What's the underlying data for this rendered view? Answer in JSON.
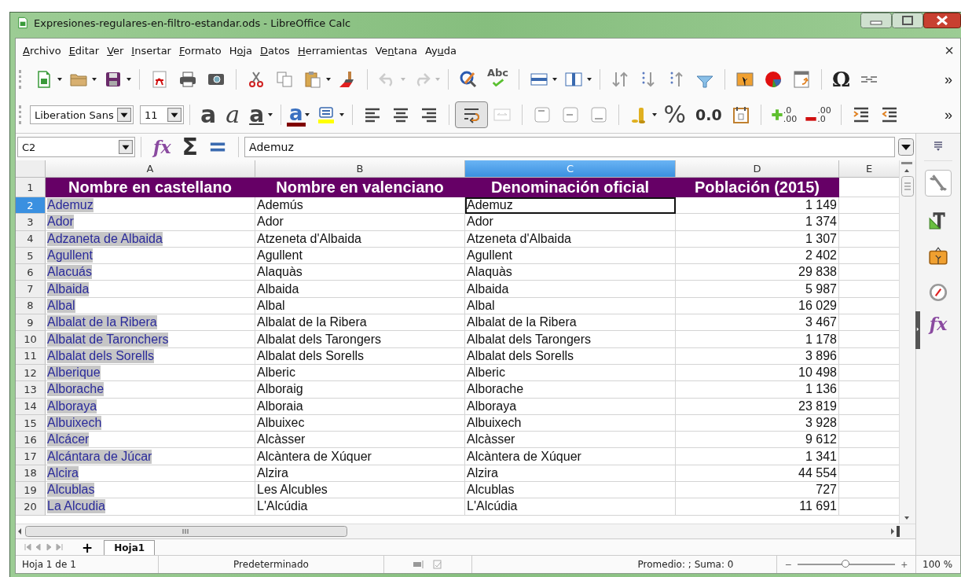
{
  "window": {
    "title": "Expresiones-regulares-en-filtro-estandar.ods - LibreOffice Calc"
  },
  "menu": [
    {
      "key": "A",
      "after": "rchivo"
    },
    {
      "key": "E",
      "after": "ditar"
    },
    {
      "key": "V",
      "after": "er"
    },
    {
      "key": "I",
      "after": "nsertar"
    },
    {
      "key": "F",
      "after": "ormato"
    },
    {
      "before": "H",
      "key": "o",
      "after": "ja"
    },
    {
      "key": "D",
      "after": "atos"
    },
    {
      "key": "H",
      "after": "erramientas"
    },
    {
      "before": "Ve",
      "key": "n",
      "after": "tana"
    },
    {
      "before": "Ay",
      "key": "u",
      "after": "da"
    }
  ],
  "close_document": "×",
  "toolbar_standard": {
    "spelling_label": "Abc",
    "special_character": "Ω",
    "more": "»"
  },
  "toolbar_formatting": {
    "font_name": "Liberation Sans",
    "font_size": "11",
    "bold": "a",
    "italic": "a",
    "underline": "a",
    "font_color": "a",
    "wrap_text_on": true,
    "percent": "%",
    "number_format": "0.0",
    "add_decimal": [
      ".0",
      ".00"
    ],
    "delete_decimal": [
      ".00",
      ".0"
    ],
    "more": "»"
  },
  "formula_bar": {
    "name_box": "C2",
    "wizard": "fx",
    "sum": "Σ",
    "content": "Ademuz"
  },
  "sheet": {
    "columns": [
      {
        "label": "A",
        "selected": false,
        "highlight": true
      },
      {
        "label": "B",
        "selected": false
      },
      {
        "label": "C",
        "selected": true
      },
      {
        "label": "D",
        "selected": false
      },
      {
        "label": "E",
        "selected": false
      }
    ],
    "rows": [
      {
        "number": "1",
        "selected": false,
        "kind": "header",
        "cells": [
          "Nombre en castellano",
          "Nombre en valenciano",
          "Denominación oficial",
          "Población (2015)"
        ]
      },
      {
        "number": "2",
        "selected": true,
        "kind": "data",
        "cells": [
          "Ademuz",
          "Ademús",
          "Ademuz",
          "1 149"
        ]
      },
      {
        "number": "3",
        "selected": false,
        "kind": "data",
        "cells": [
          "Ador",
          "Ador",
          "Ador",
          "1 374"
        ]
      },
      {
        "number": "4",
        "selected": false,
        "kind": "data",
        "cells": [
          "Adzaneta de Albaida",
          "Atzeneta d'Albaida",
          "Atzeneta d'Albaida",
          "1 307"
        ]
      },
      {
        "number": "5",
        "selected": false,
        "kind": "data",
        "cells": [
          "Agullent",
          "Agullent",
          "Agullent",
          "2 402"
        ]
      },
      {
        "number": "6",
        "selected": false,
        "kind": "data",
        "cells": [
          "Alacuás",
          "Alaquàs",
          "Alaquàs",
          "29 838"
        ]
      },
      {
        "number": "7",
        "selected": false,
        "kind": "data",
        "cells": [
          "Albaida",
          "Albaida",
          "Albaida",
          "5 987"
        ]
      },
      {
        "number": "8",
        "selected": false,
        "kind": "data",
        "cells": [
          "Albal",
          "Albal",
          "Albal",
          "16 029"
        ]
      },
      {
        "number": "9",
        "selected": false,
        "kind": "data",
        "cells": [
          "Albalat de la Ribera",
          "Albalat de la Ribera",
          "Albalat de la Ribera",
          "3 467"
        ]
      },
      {
        "number": "10",
        "selected": false,
        "kind": "data",
        "cells": [
          "Albalat de Taronchers",
          "Albalat dels Tarongers",
          "Albalat dels Tarongers",
          "1 178"
        ]
      },
      {
        "number": "11",
        "selected": false,
        "kind": "data",
        "cells": [
          "Albalat dels Sorells",
          "Albalat dels Sorells",
          "Albalat dels Sorells",
          "3 896"
        ]
      },
      {
        "number": "12",
        "selected": false,
        "kind": "data",
        "cells": [
          "Alberique",
          "Alberic",
          "Alberic",
          "10 498"
        ]
      },
      {
        "number": "13",
        "selected": false,
        "kind": "data",
        "cells": [
          "Alborache",
          "Alboraig",
          "Alborache",
          "1 136"
        ]
      },
      {
        "number": "14",
        "selected": false,
        "kind": "data",
        "cells": [
          "Alboraya",
          "Alboraia",
          "Alboraya",
          "23 819"
        ]
      },
      {
        "number": "15",
        "selected": false,
        "kind": "data",
        "cells": [
          "Albuixech",
          "Albuixec",
          "Albuixech",
          "3 928"
        ]
      },
      {
        "number": "16",
        "selected": false,
        "kind": "data",
        "cells": [
          "Alcácer",
          "Alcàsser",
          "Alcàsser",
          "9 612"
        ]
      },
      {
        "number": "17",
        "selected": false,
        "kind": "data",
        "cells": [
          "Alcántara de Júcar",
          "Alcàntera de Xúquer",
          "Alcàntera de Xúquer",
          "1 341"
        ]
      },
      {
        "number": "18",
        "selected": false,
        "kind": "data",
        "cells": [
          "Alcira",
          "Alzira",
          "Alzira",
          "44 554"
        ]
      },
      {
        "number": "19",
        "selected": false,
        "kind": "data",
        "cells": [
          "Alcublas",
          "Les Alcubles",
          "Alcublas",
          "727"
        ]
      },
      {
        "number": "20",
        "selected": false,
        "kind": "data",
        "cells": [
          "La Alcudia",
          "L'Alcúdia",
          "L'Alcúdia",
          "11 691"
        ]
      }
    ]
  },
  "sheet_tabs": {
    "add": "+",
    "tabs": [
      {
        "label": "Hoja1",
        "selected": true
      }
    ]
  },
  "sidebar": {
    "functions": "fx"
  },
  "status_bar": {
    "sheet": "Hoja 1 de 1",
    "page_style": "Predeterminado",
    "summary": "Promedio: ; Suma: 0",
    "zoom_out": "−",
    "zoom_in": "+",
    "zoom_slider": {
      "level": 0.5
    },
    "zoom": "100 %"
  }
}
